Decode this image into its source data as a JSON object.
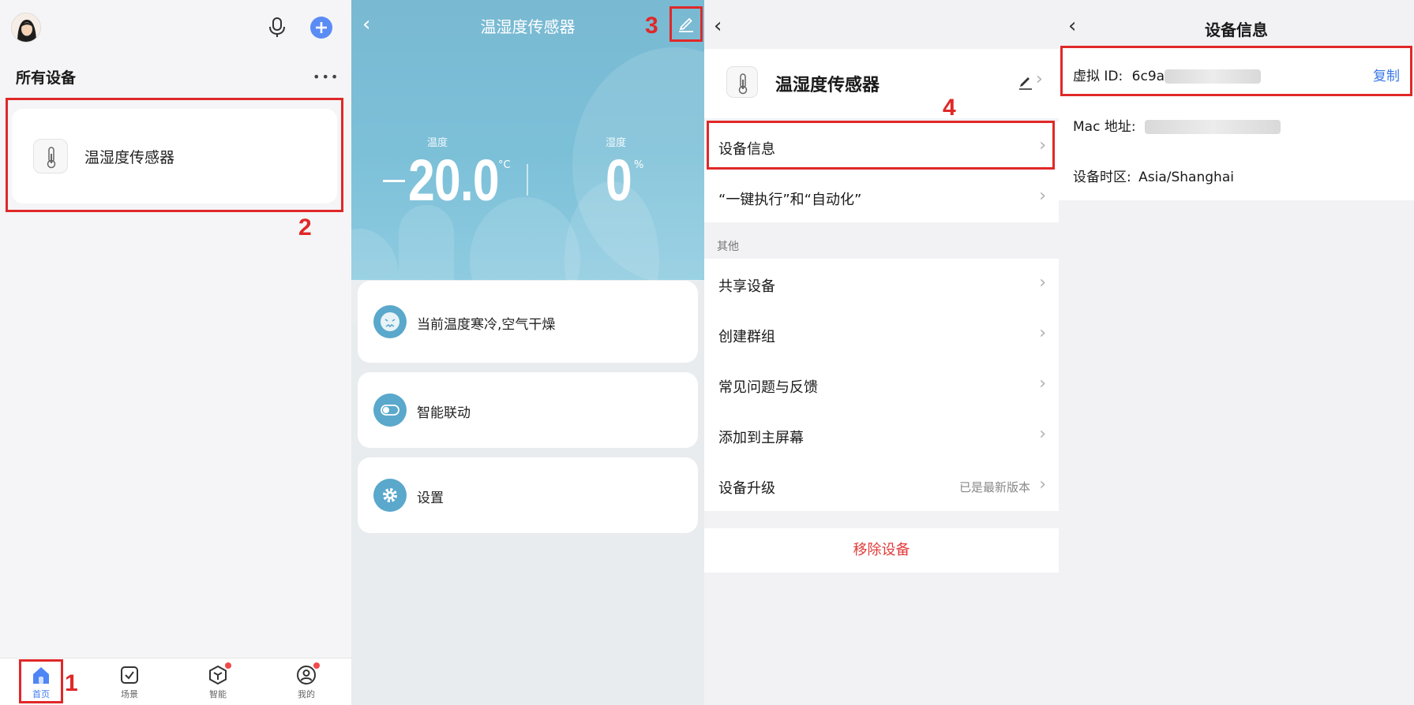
{
  "home": {
    "section_title": "所有设备",
    "device_name": "温湿度传感器",
    "tabs": [
      {
        "label": "首页",
        "icon": "home-icon"
      },
      {
        "label": "场景",
        "icon": "scene-check-icon"
      },
      {
        "label": "智能",
        "icon": "smart-cube-icon"
      },
      {
        "label": "我的",
        "icon": "profile-icon"
      }
    ]
  },
  "sensor": {
    "title": "温湿度传感器",
    "temp_label": "温度",
    "temp_value": "20.0",
    "temp_unit": "°C",
    "hum_label": "湿度",
    "hum_value": "0",
    "hum_unit": "%",
    "cards": [
      {
        "label": "当前温度寒冷,空气干燥",
        "icon": "face-cold-icon"
      },
      {
        "label": "智能联动",
        "icon": "toggle-icon"
      },
      {
        "label": "设置",
        "icon": "gear-icon"
      }
    ]
  },
  "settings": {
    "device_name": "温湿度传感器",
    "rows_top": [
      {
        "label": "设备信息"
      },
      {
        "label": "“一键执行”和“自动化”"
      }
    ],
    "section_other": "其他",
    "rows_other": [
      {
        "label": "共享设备",
        "value": ""
      },
      {
        "label": "创建群组",
        "value": ""
      },
      {
        "label": "常见问题与反馈",
        "value": ""
      },
      {
        "label": "添加到主屏幕",
        "value": ""
      },
      {
        "label": "设备升级",
        "value": "已是最新版本"
      }
    ],
    "remove_label": "移除设备"
  },
  "info": {
    "title": "设备信息",
    "virtual_id_label": "虚拟 ID:",
    "virtual_id_value": "6c9a",
    "copy_label": "复制",
    "mac_label": "Mac 地址:",
    "timezone_label": "设备时区:",
    "timezone_value": "Asia/Shanghai"
  },
  "steps": [
    "1",
    "2",
    "3",
    "4"
  ],
  "colors": {
    "accent": "#3d7bf2",
    "highlight": "#e02828",
    "danger": "#e23b3b",
    "sky": "#79b9d2"
  }
}
